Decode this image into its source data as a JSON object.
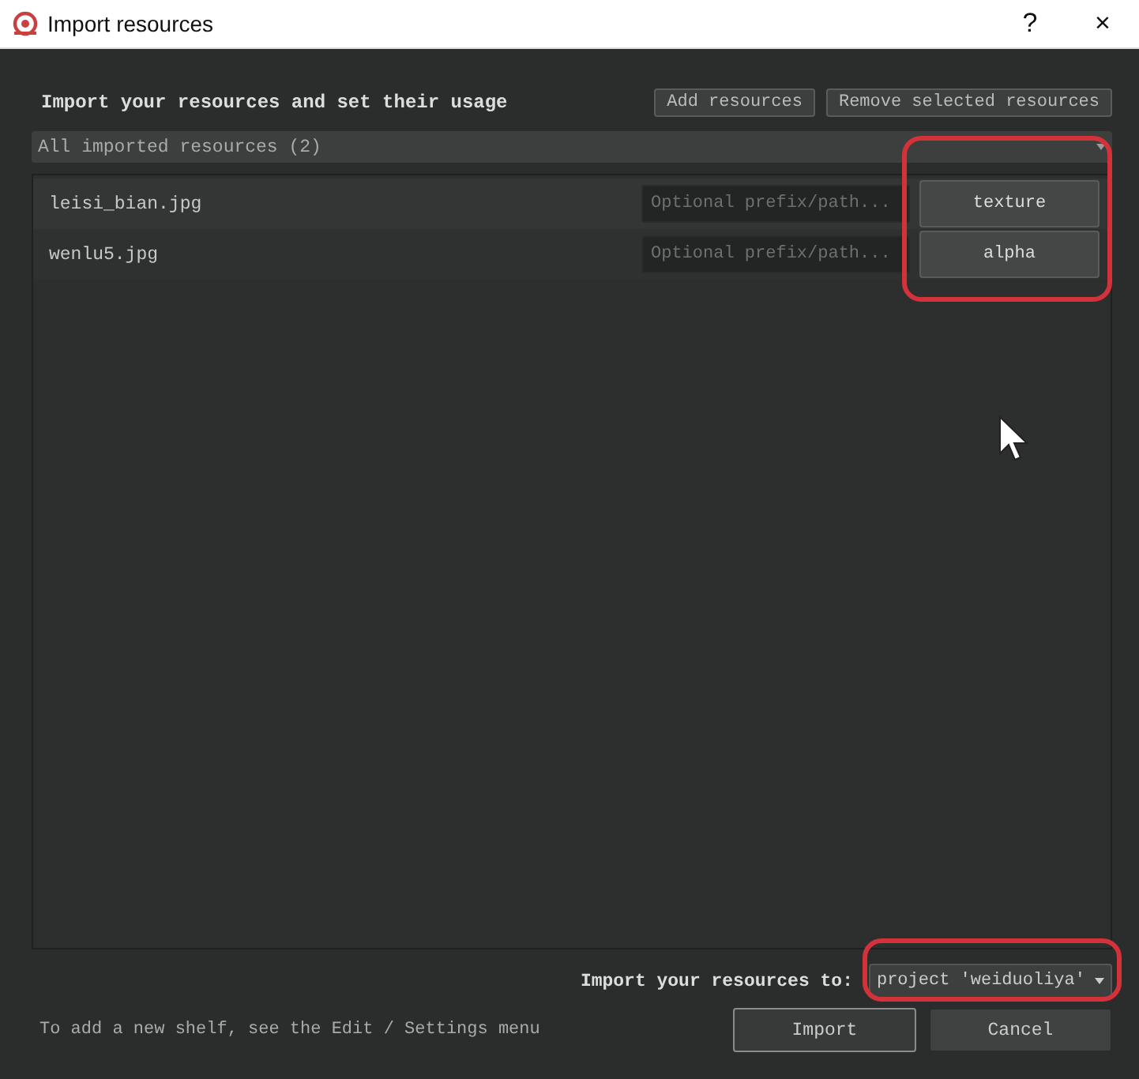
{
  "window": {
    "title": "Import resources",
    "help_button": "?",
    "close_button": "×"
  },
  "heading": "Import your resources and set their usage",
  "toolbar_buttons": [
    "Add resources",
    "Remove selected resources"
  ],
  "group": {
    "label": "All imported resources (2)",
    "expanded": true
  },
  "resources": [
    {
      "file": "leisi_bian.jpg",
      "prefix_placeholder": "Optional prefix/path...",
      "usage": "texture"
    },
    {
      "file": "wenlu5.jpg",
      "prefix_placeholder": "Optional prefix/path...",
      "usage": "alpha"
    }
  ],
  "usage_highlighted": true,
  "destination": {
    "label": "Import your resources to:",
    "value": "project 'weiduoliya'",
    "highlighted": true
  },
  "hint": "To add a new shelf, see the Edit / Settings menu",
  "buttons": [
    {
      "label": "Import",
      "default": true
    },
    {
      "label": "Cancel",
      "default": false
    }
  ]
}
